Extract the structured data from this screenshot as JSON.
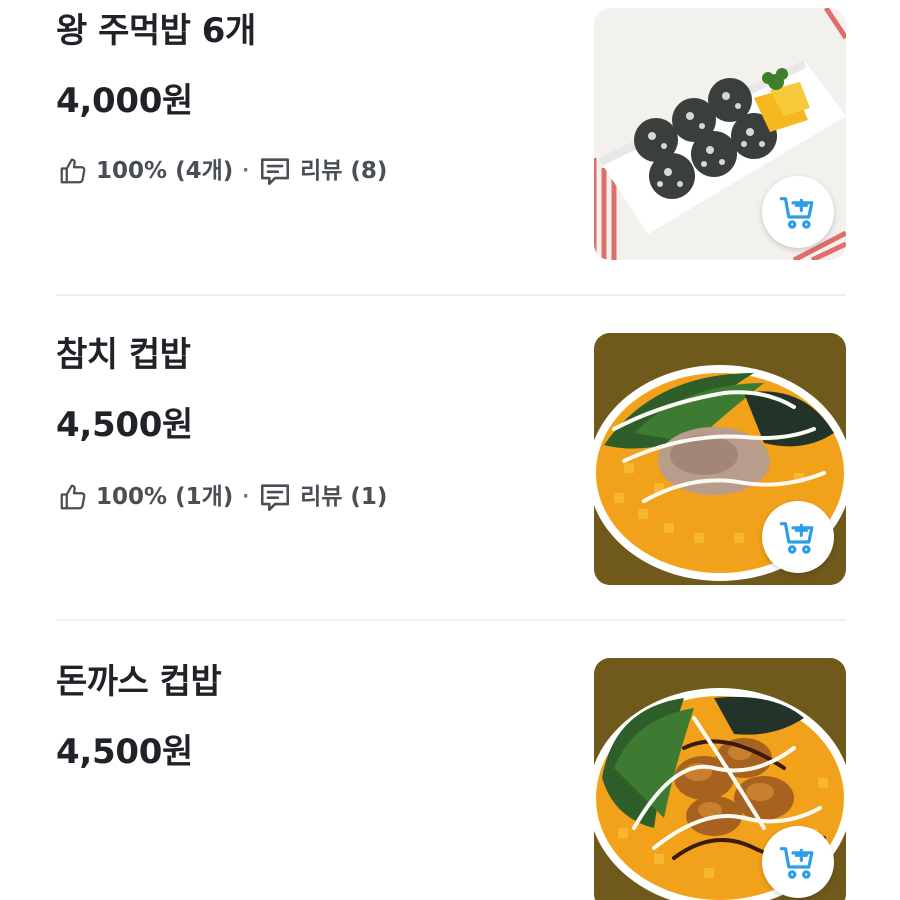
{
  "items": [
    {
      "name": "왕 주먹밥 6개",
      "price": "4,000원",
      "rating": "100% (4개)",
      "separator": "·",
      "review_label": "리뷰 (8)",
      "image_icon": "rice-ball-photo"
    },
    {
      "name": "참치 컵밥",
      "price": "4,500원",
      "rating": "100% (1개)",
      "separator": "·",
      "review_label": "리뷰 (1)",
      "image_icon": "tuna-rice-bowl-photo"
    },
    {
      "name": "돈까스 컵밥",
      "price": "4,500원",
      "image_icon": "pork-cutlet-rice-bowl-photo"
    }
  ],
  "icons": {
    "like": "thumbs-up-icon",
    "review": "speech-bubble-icon",
    "cart": "add-to-cart-icon"
  },
  "colors": {
    "cart_icon": "#2a9ee8",
    "text_primary": "#1f2328",
    "text_secondary": "#4a4f55",
    "divider": "#eef0f2"
  }
}
